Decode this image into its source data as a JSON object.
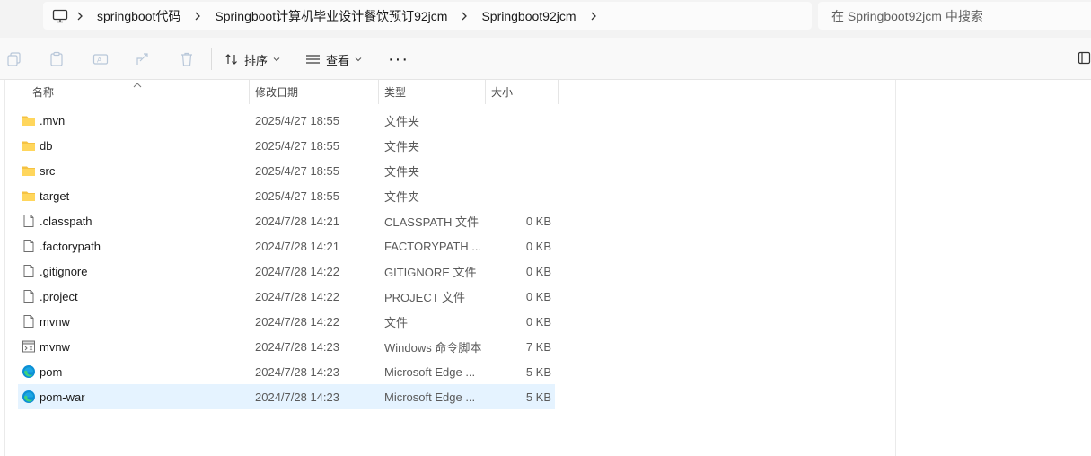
{
  "address_bar": {
    "crumbs": [
      "springboot代码",
      "Springboot计算机毕业设计餐饮预订92jcm",
      "Springboot92jcm"
    ],
    "search_placeholder": "在 Springboot92jcm 中搜索"
  },
  "toolbar": {
    "sort_label": "排序",
    "view_label": "查看",
    "more_label": "···"
  },
  "columns": {
    "name": "名称",
    "date": "修改日期",
    "type": "类型",
    "size": "大小"
  },
  "files": [
    {
      "name": ".mvn",
      "date": "2025/4/27 18:55",
      "type": "文件夹",
      "size": "",
      "icon": "folder-icon"
    },
    {
      "name": "db",
      "date": "2025/4/27 18:55",
      "type": "文件夹",
      "size": "",
      "icon": "folder-icon"
    },
    {
      "name": "src",
      "date": "2025/4/27 18:55",
      "type": "文件夹",
      "size": "",
      "icon": "folder-icon"
    },
    {
      "name": "target",
      "date": "2025/4/27 18:55",
      "type": "文件夹",
      "size": "",
      "icon": "folder-icon"
    },
    {
      "name": ".classpath",
      "date": "2024/7/28 14:21",
      "type": "CLASSPATH 文件",
      "size": "0 KB",
      "icon": "file-icon"
    },
    {
      "name": ".factorypath",
      "date": "2024/7/28 14:21",
      "type": "FACTORYPATH ...",
      "size": "0 KB",
      "icon": "file-icon"
    },
    {
      "name": ".gitignore",
      "date": "2024/7/28 14:22",
      "type": "GITIGNORE 文件",
      "size": "0 KB",
      "icon": "file-icon"
    },
    {
      "name": ".project",
      "date": "2024/7/28 14:22",
      "type": "PROJECT 文件",
      "size": "0 KB",
      "icon": "file-icon"
    },
    {
      "name": "mvnw",
      "date": "2024/7/28 14:22",
      "type": "文件",
      "size": "0 KB",
      "icon": "file-icon"
    },
    {
      "name": "mvnw",
      "date": "2024/7/28 14:23",
      "type": "Windows 命令脚本",
      "size": "7 KB",
      "icon": "script-icon"
    },
    {
      "name": "pom",
      "date": "2024/7/28 14:23",
      "type": "Microsoft Edge ...",
      "size": "5 KB",
      "icon": "edge-icon"
    },
    {
      "name": "pom-war",
      "date": "2024/7/28 14:23",
      "type": "Microsoft Edge ...",
      "size": "5 KB",
      "icon": "edge-icon"
    }
  ],
  "selected_index": 11,
  "colors": {
    "folder": "#f5c242",
    "edge": "#0c8fd6",
    "selection": "#e5f3ff"
  }
}
